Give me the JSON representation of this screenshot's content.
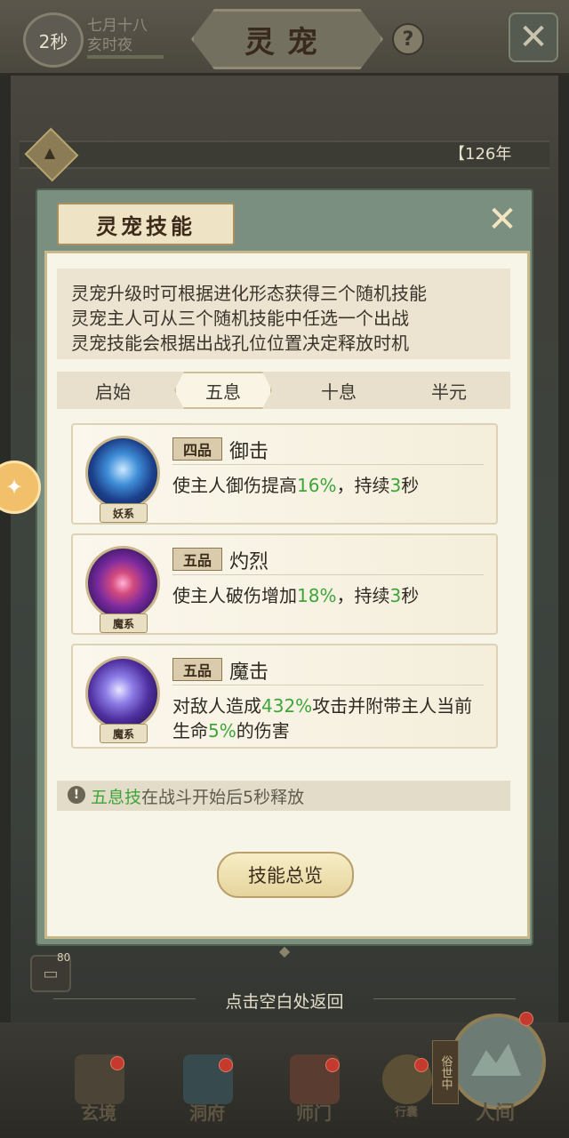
{
  "header": {
    "timer": "2秒",
    "date_line1": "七月十八",
    "date_line2": "亥时夜",
    "title": "灵宠",
    "help_symbol": "?"
  },
  "background": {
    "year_label": "【126年"
  },
  "modal": {
    "title": "灵宠技能",
    "description": [
      "灵宠升级时可根据进化形态获得三个随机技能",
      "灵宠主人可从三个随机技能中任选一个出战",
      "灵宠技能会根据出战孔位位置决定释放时机"
    ],
    "tabs": [
      {
        "label": "启始",
        "active": false
      },
      {
        "label": "五息",
        "active": true
      },
      {
        "label": "十息",
        "active": false
      },
      {
        "label": "半元",
        "active": false
      }
    ],
    "skills": [
      {
        "grade": "四品",
        "name": "御击",
        "type": "妖系",
        "icon": "blue-orb-icon",
        "desc_parts": [
          "使主人御伤提高",
          "16%",
          "，持续",
          "3",
          "秒"
        ]
      },
      {
        "grade": "五品",
        "name": "灼烈",
        "type": "魔系",
        "icon": "purple-flame-icon",
        "desc_parts": [
          "使主人破伤增加",
          "18%",
          "，持续",
          "3",
          "秒"
        ]
      },
      {
        "grade": "五品",
        "name": "魔击",
        "type": "魔系",
        "icon": "purple-dragon-icon",
        "desc_parts": [
          "对敌人造成",
          "432%",
          "攻击并附带主人当前生命",
          "5%",
          "的伤害"
        ]
      }
    ],
    "note_highlight": "五息技",
    "note_text": "在战斗开始后5秒释放",
    "overview_button": "技能总览"
  },
  "chat": {
    "count": "80"
  },
  "return_hint": "点击空白处返回",
  "bottom_nav": {
    "items": [
      "玄境",
      "洞府",
      "师门",
      "行囊"
    ],
    "world_label": "人间",
    "world_vertical": "俗世中"
  },
  "colors": {
    "highlight_green": "#3fa53a",
    "modal_frame": "#7a8f80",
    "panel_bg": "#f7f4e8"
  }
}
